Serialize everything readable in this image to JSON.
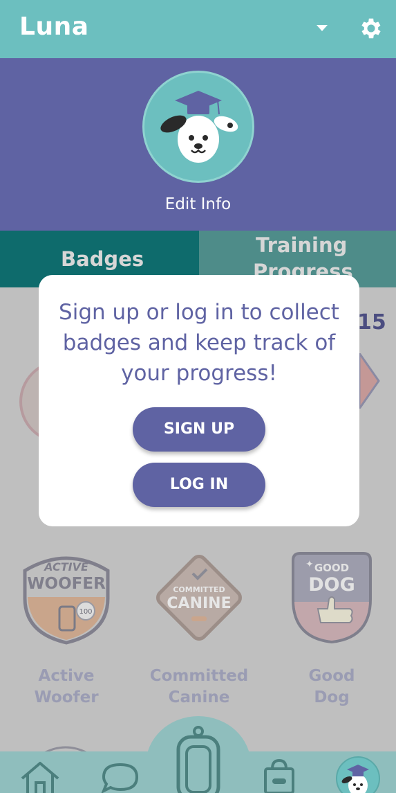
{
  "header": {
    "title": "Luna",
    "dropdown_icon": "chevron-down-icon",
    "settings_icon": "gear-icon"
  },
  "profile": {
    "avatar_icon": "dog-graduate-icon",
    "edit_label": "Edit Info"
  },
  "tabs": [
    {
      "label": "Badges",
      "active": true
    },
    {
      "label_line1": "Training",
      "label_line2": "Progress",
      "active": false
    }
  ],
  "badges_count": "15",
  "badges": [
    {
      "emblem_line1": "ACTIVE",
      "emblem_line2": "WOOFER",
      "emblem_tag": "100",
      "name_line1": "Active",
      "name_line2": "Woofer"
    },
    {
      "emblem_line1": "COMMITTED",
      "emblem_line2": "CANINE",
      "name_line1": "Committed",
      "name_line2": "Canine"
    },
    {
      "emblem_line1": "GOOD",
      "emblem_line2": "DOG",
      "name_line1": "Good",
      "name_line2": "Dog"
    }
  ],
  "modal": {
    "message_line1": "Sign up or log in to collect",
    "message_line2": "badges and keep track of",
    "message_line3": "your progress!",
    "signup_label": "SIGN UP",
    "login_label": "LOG IN"
  },
  "bottom_nav": {
    "items": [
      "home-icon",
      "chat-icon",
      "dog-tag-icon",
      "shop-bag-icon",
      "profile-avatar-icon"
    ]
  },
  "colors": {
    "teal": "#6cbfbf",
    "purple": "#5f63a3",
    "dark_teal_tab": "#0e6b6c",
    "overlay_grey": "#bfbfbf",
    "nav_bg": "#8fbebd"
  }
}
